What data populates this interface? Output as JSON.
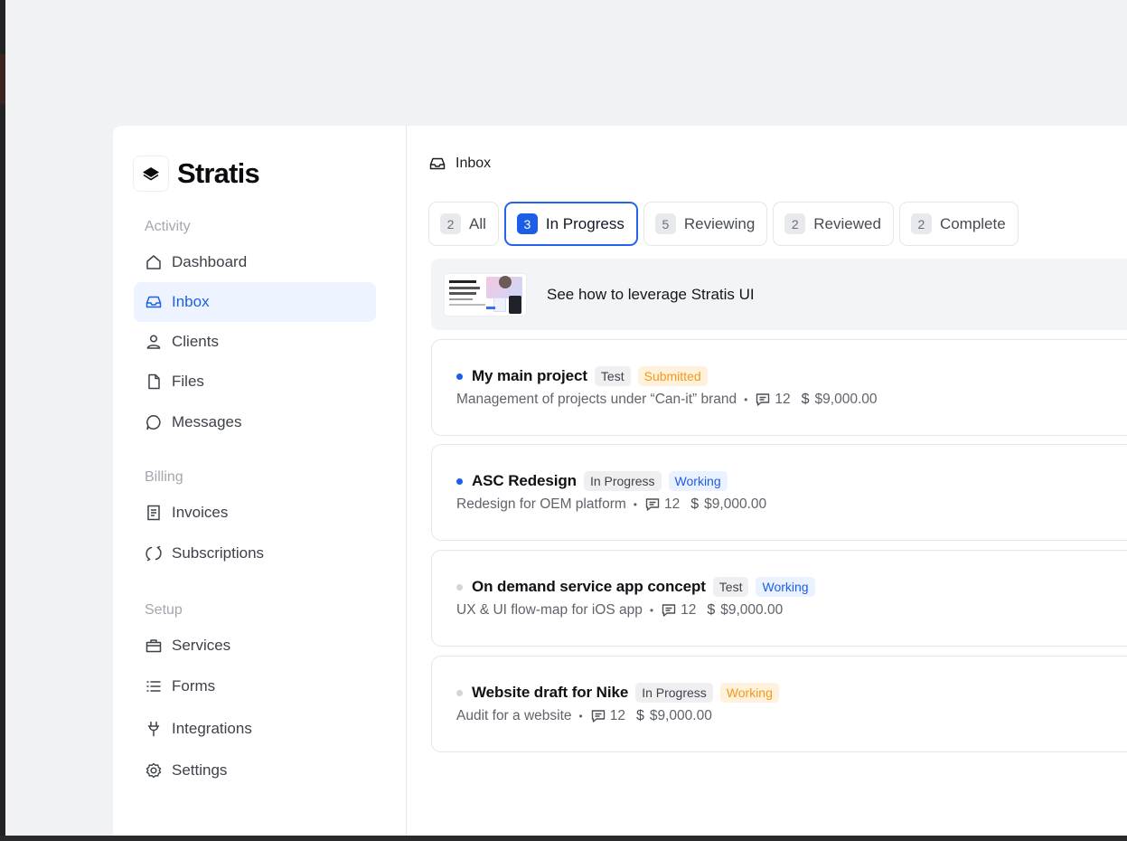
{
  "brand": {
    "name": "Stratis"
  },
  "sidebar": {
    "sections": [
      {
        "label": "Activity"
      },
      {
        "label": "Billing"
      },
      {
        "label": "Setup"
      }
    ],
    "items": [
      {
        "label": "Dashboard",
        "icon": "home-icon"
      },
      {
        "label": "Inbox",
        "icon": "inbox-icon",
        "active": true
      },
      {
        "label": "Clients",
        "icon": "user-icon"
      },
      {
        "label": "Files",
        "icon": "file-icon"
      },
      {
        "label": "Messages",
        "icon": "message-icon"
      },
      {
        "label": "Invoices",
        "icon": "invoice-icon"
      },
      {
        "label": "Subscriptions",
        "icon": "refresh-icon"
      },
      {
        "label": "Services",
        "icon": "briefcase-icon"
      },
      {
        "label": "Forms",
        "icon": "list-icon"
      },
      {
        "label": "Integrations",
        "icon": "plug-icon"
      },
      {
        "label": "Settings",
        "icon": "gear-icon"
      }
    ]
  },
  "header": {
    "title": "Inbox",
    "icon": "inbox-icon"
  },
  "tabs": [
    {
      "count": "2",
      "label": "All"
    },
    {
      "count": "3",
      "label": "In Progress",
      "active": true
    },
    {
      "count": "5",
      "label": "Reviewing"
    },
    {
      "count": "2",
      "label": "Reviewed"
    },
    {
      "count": "2",
      "label": "Complete"
    }
  ],
  "promo": {
    "text": "See how to leverage Stratis UI"
  },
  "projects": [
    {
      "title": "My main project",
      "tag": "Test",
      "status": "Submitted",
      "status_color": "#f19a18",
      "description": "Management of projects under “Can-it” brand",
      "comments": "12",
      "amount": "$9,000.00",
      "unread": true
    },
    {
      "title": "ASC Redesign",
      "tag": "In Progress",
      "status": "Working",
      "status_color": "#1d5ee8",
      "description": "Redesign for OEM platform",
      "comments": "12",
      "amount": "$9,000.00",
      "unread": true
    },
    {
      "title": "On demand service app concept",
      "tag": "Test",
      "status": "Working",
      "status_color": "#1d5ee8",
      "description": "UX & UI flow-map for iOS app",
      "comments": "12",
      "amount": "$9,000.00",
      "unread": false
    },
    {
      "title": "Website draft for Nike",
      "tag": "In Progress",
      "status": "Working",
      "status_color": "#f19a18",
      "description": "Audit for a website",
      "comments": "12",
      "amount": "$9,000.00",
      "unread": false
    }
  ],
  "colors": {
    "accent": "#1d5ee8",
    "active_bg": "#eef4ff",
    "warning": "#f19a18"
  },
  "symbols": {
    "bullet": "•",
    "dollar": "$"
  }
}
